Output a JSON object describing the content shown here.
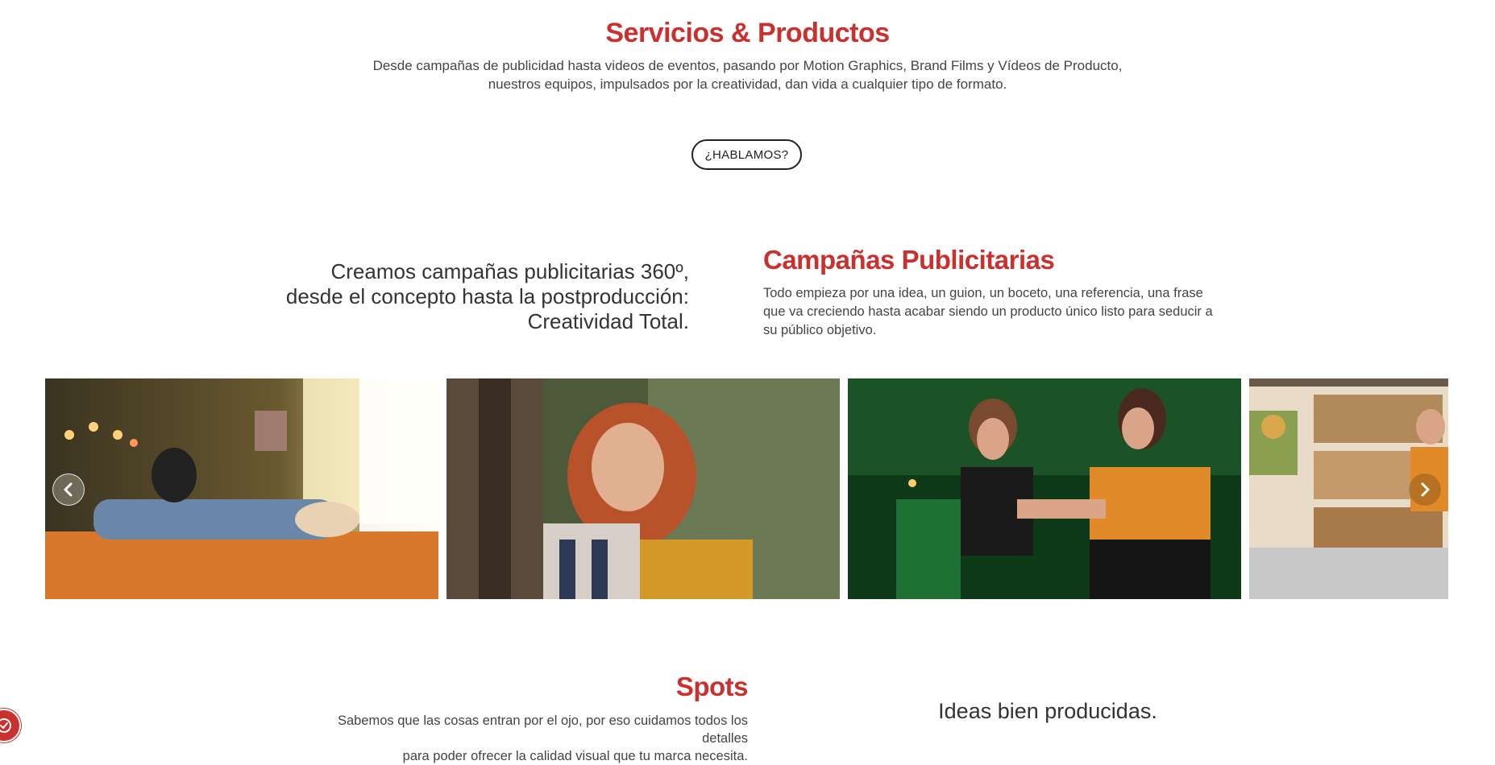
{
  "services": {
    "title": "Servicios & Productos",
    "description": "Desde campañas de publicidad hasta videos de eventos, pasando por Motion Graphics, Brand Films y Vídeos de Producto, nuestros equipos, impulsados por la creatividad, dan vida a cualquier tipo de formato.",
    "cta_label": "¿HABLAMOS?"
  },
  "campaigns": {
    "tagline_line1": "Creamos campañas publicitarias 360º,",
    "tagline_line2": "desde el concepto hasta la postproducción:",
    "tagline_line3": "Creatividad Total.",
    "title": "Campañas Publicitarias",
    "description": "Todo empieza por una idea, un guion, un boceto, una referencia, una frase que va creciendo hasta acabar siendo un producto único listo para seducir a su público objetivo."
  },
  "carousel": {
    "slides": [
      "bedroom-scene",
      "forest-scene",
      "tattoo-studio-scene",
      "bakery-shop-scene"
    ],
    "prev_icon": "chevron-left-icon",
    "next_icon": "chevron-right-icon"
  },
  "spots": {
    "title": "Spots",
    "description_line1": "Sabemos que las cosas entran por el ojo, por eso cuidamos todos los detalles",
    "description_line2": "para poder ofrecer la calidad visual que tu marca necesita.",
    "tagline": "Ideas bien producidas."
  },
  "colors": {
    "accent": "#c8312e",
    "text": "#333333"
  },
  "badge_icon": "check-shield-icon"
}
